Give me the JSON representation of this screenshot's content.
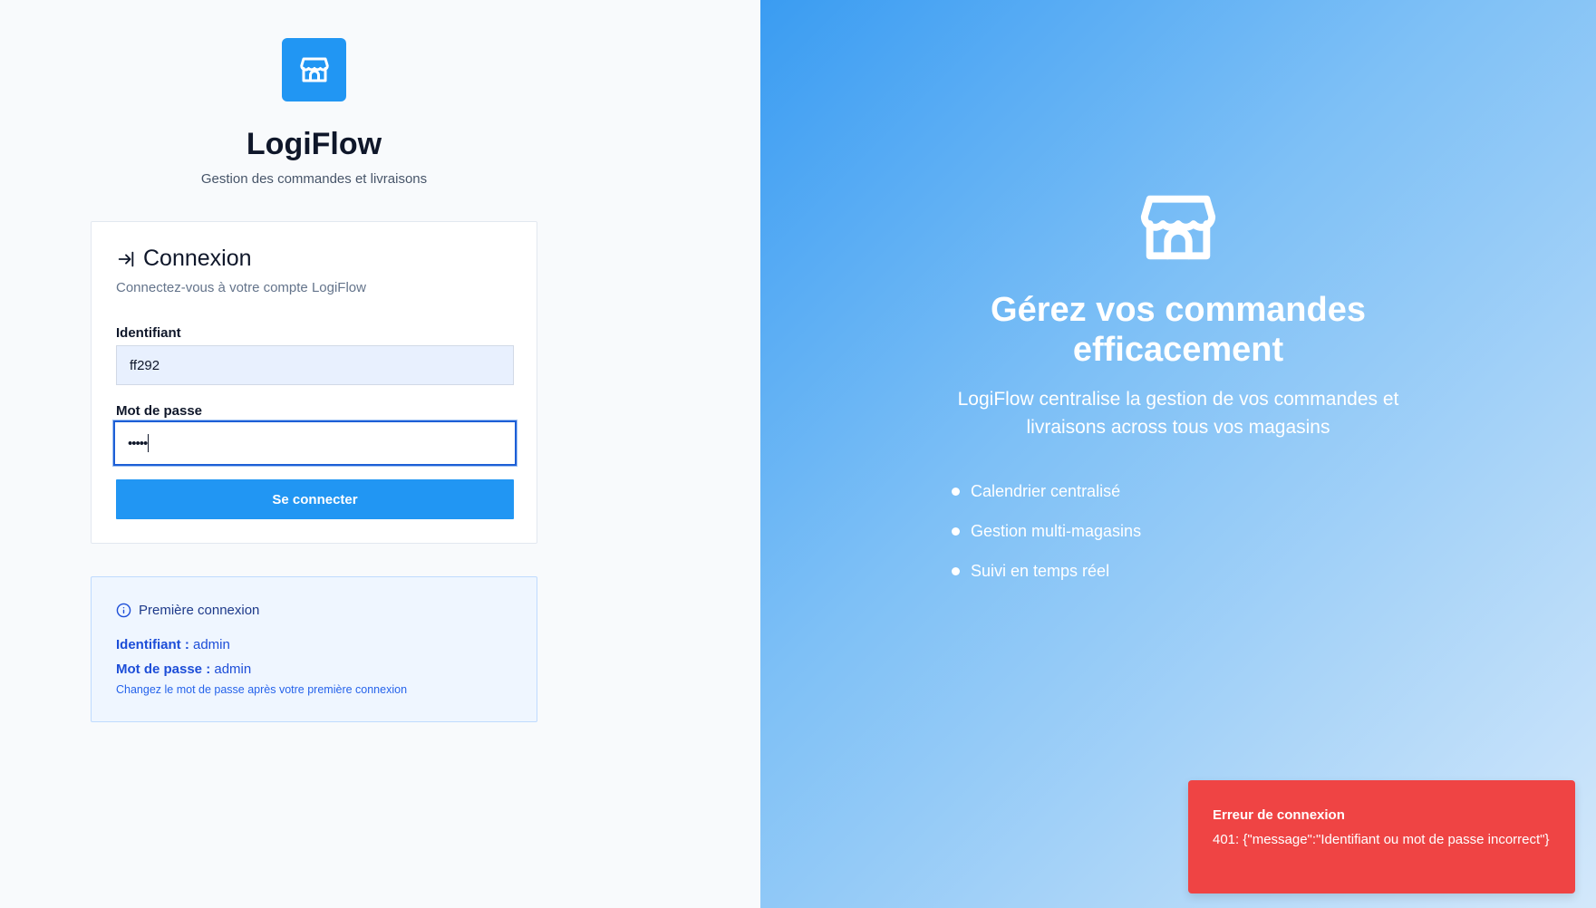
{
  "app": {
    "name": "LogiFlow",
    "tagline": "Gestion des commandes et livraisons",
    "brand_color": "#2196f3"
  },
  "login": {
    "title": "Connexion",
    "subtitle": "Connectez-vous à votre compte LogiFlow",
    "username_label": "Identifiant",
    "username_value": "ff292",
    "password_label": "Mot de passe",
    "password_masked": "•••••",
    "submit_label": "Se connecter"
  },
  "first_login": {
    "title": "Première connexion",
    "username_key": "Identifiant :",
    "username_value": "admin",
    "password_key": "Mot de passe :",
    "password_value": "admin",
    "note": "Changez le mot de passe après votre première connexion"
  },
  "hero": {
    "title": "Gérez vos commandes efficacement",
    "description": "LogiFlow centralise la gestion de vos commandes et livraisons across tous vos magasins",
    "features": [
      "Calendrier centralisé",
      "Gestion multi-magasins",
      "Suivi en temps réel"
    ]
  },
  "toast": {
    "title": "Erreur de connexion",
    "message": "401: {\"message\":\"Identifiant ou mot de passe incorrect\"}",
    "color": "#ef4444"
  },
  "icons": {
    "logo": "store-icon",
    "login": "login-arrow-icon",
    "info": "info-circle-icon"
  }
}
